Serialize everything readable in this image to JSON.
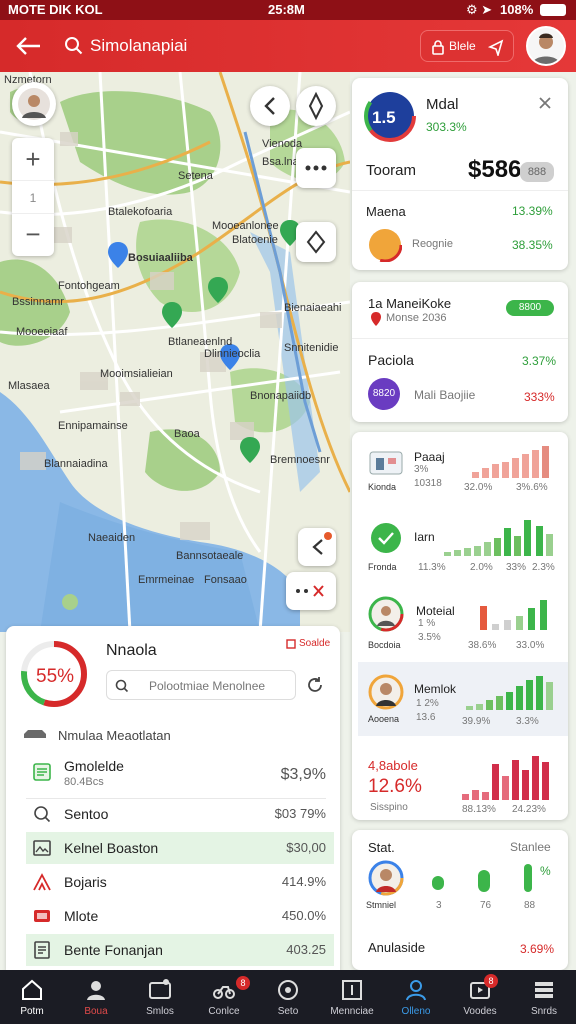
{
  "status": {
    "left": "MOTE DIK KOL",
    "time": "25:8M",
    "battery": "108%"
  },
  "appbar": {
    "search_text": "Simolanapiai",
    "pill_label": "Blele"
  },
  "map": {
    "labels": [
      "Nzmetorn",
      "Vienoda",
      "Bsa.lna",
      "Setena",
      "Btalekofoaria",
      "Mooeanlonee",
      "Blatoenie",
      "Bosuiaaliiba",
      "Fontohgeam",
      "Bssinnamr",
      "Bienaiaeahi",
      "Mooeeiaaf",
      "Btlaneaenlnd",
      "Dlinnieoclia",
      "Snnitenidie",
      "Mooimsialieian",
      "Mlasaea",
      "Bnonapaiidb",
      "Baoa",
      "Ennipamainse",
      "Blannaiadina",
      "Naeaiden",
      "Bannsotaeale",
      "Emrmeinae",
      "Bremnoesnr",
      "Fonsaao"
    ]
  },
  "card_top": {
    "score": "1.5",
    "title": "Mdal",
    "sub": "303.3%",
    "row_label": "Tooram",
    "price": "$586",
    "pill": "888",
    "item1_label": "Maena",
    "item1_value": "13.39%",
    "item2_label": "Reognie",
    "item2_value": "38.35%"
  },
  "card_mid": {
    "title": "1a ManeiKoke",
    "sub": "Monse 2036",
    "badge": "8800",
    "row1_label": "Paciola",
    "row1_value": "3.37%",
    "avatar_text": "8820",
    "row2_label": "Mali Baojiie",
    "row2_value": "333%"
  },
  "list": [
    {
      "title": "Paaaj",
      "pct": "3%",
      "sub": "10318",
      "v1": "32.0%",
      "v2": "3%.6%",
      "name": "Kionda"
    },
    {
      "title": "Iarn",
      "pct": "",
      "sub": "11.3%",
      "v1": "2.0%",
      "v2": "33%",
      "v3": "2.3%",
      "name": "Fronda"
    },
    {
      "title": "Moteial",
      "pct": "1 %",
      "sub": "3.5%",
      "v1": "38.6%",
      "v2": "33.0%",
      "name": "Bocdoia"
    },
    {
      "title": "Memlok",
      "pct": "1 2%",
      "sub": "13.6",
      "v1": "39.9%",
      "v2": "3.3%",
      "name": "Aooena"
    },
    {
      "title": "4,8abole",
      "big": "12.6%",
      "sub": "Sisspino",
      "v1": "88.13%",
      "v2": "24.23%"
    }
  ],
  "stat_card": {
    "title": "Stat.",
    "right": "Stanlee",
    "name": "Stmniel",
    "pct": "%",
    "items": [
      "3",
      "76",
      "88"
    ]
  },
  "bottom_right": {
    "label": "Anulaside",
    "value": "3.69%"
  },
  "sheet": {
    "ring_value": "55%",
    "title": "Nnaola",
    "action": "Soalde",
    "search_placeholder": "Polootmiae Menolnee",
    "section": "Nmulaa Meaotlatan",
    "rows": [
      {
        "label": "Gmolelde",
        "sub": "80.4Bcs",
        "value": "$3,9%",
        "highlight": false,
        "green": true
      },
      {
        "label": "Sentoo",
        "value": "$03 79%",
        "highlight": false
      },
      {
        "label": "Kelnel Boaston",
        "value": "$30,00",
        "highlight": true
      },
      {
        "label": "Bojaris",
        "value": "414.9%",
        "highlight": false
      },
      {
        "label": "Mlote",
        "value": "450.0%",
        "highlight": false
      },
      {
        "label": "Bente Fonanjan",
        "value": "403.25",
        "highlight": true
      }
    ]
  },
  "nav": [
    {
      "label": "Potm",
      "active": false
    },
    {
      "label": "Boua",
      "active": false,
      "red": true
    },
    {
      "label": "Smlos",
      "active": false
    },
    {
      "label": "Conlce",
      "active": false,
      "badge": "8"
    },
    {
      "label": "Seto",
      "active": false
    },
    {
      "label": "Mennciae",
      "active": false
    },
    {
      "label": "Olleno",
      "active": true
    },
    {
      "label": "Voodes",
      "active": false,
      "badge": "8"
    },
    {
      "label": "Snrds",
      "active": false
    }
  ],
  "colors": {
    "accent": "#d62a2a",
    "green": "#2e9e3a",
    "navbg": "#1b1c24"
  }
}
